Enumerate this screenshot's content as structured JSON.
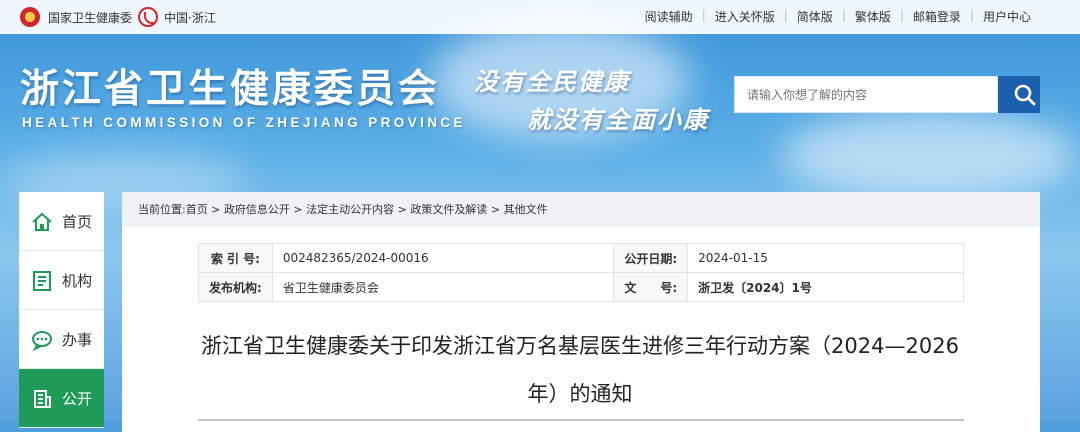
{
  "topbar": {
    "org_name": "国家卫生健康委",
    "china_zhejiang": "中国·浙江",
    "links": [
      "阅读辅助",
      "进入关怀版",
      "简体版",
      "繁体版",
      "邮箱登录",
      "用户中心"
    ]
  },
  "header": {
    "title": "浙江省卫生健康委员会",
    "subtitle": "HEALTH COMMISSION OF ZHEJIANG PROVINCE",
    "slogan_line1": "没有全民健康",
    "slogan_line2": "就没有全面小康"
  },
  "search": {
    "placeholder": "请输入你想了解的内容",
    "icon": "search-icon"
  },
  "sidenav": {
    "items": [
      {
        "label": "首页",
        "icon": "home-icon"
      },
      {
        "label": "机构",
        "icon": "institution-icon"
      },
      {
        "label": "办事",
        "icon": "service-chat-icon"
      },
      {
        "label": "公开",
        "icon": "building-icon"
      }
    ],
    "active_color": "#1e9b58"
  },
  "breadcrumb": {
    "prefix": "当前位置:",
    "items": [
      "首页",
      "政府信息公开",
      "法定主动公开内容",
      "政策文件及解读",
      "其他文件"
    ],
    "separator": " > "
  },
  "meta": {
    "index_label": "索 引 号:",
    "index_value": "002482365/2024-00016",
    "date_label": "公开日期:",
    "date_value": "2024-01-15",
    "issuer_label": "发布机构:",
    "issuer_value": "省卫生健康委员会",
    "docno_label": "文　　号:",
    "docno_value": "浙卫发〔2024〕1号"
  },
  "document": {
    "title_line1": "浙江省卫生健康委关于印发浙江省万名基层医生进修三年行动方案（2024—2026",
    "title_line2": "年）的通知"
  },
  "colors": {
    "brand_blue": "#1b5fae",
    "nav_active": "#1e9b58"
  }
}
